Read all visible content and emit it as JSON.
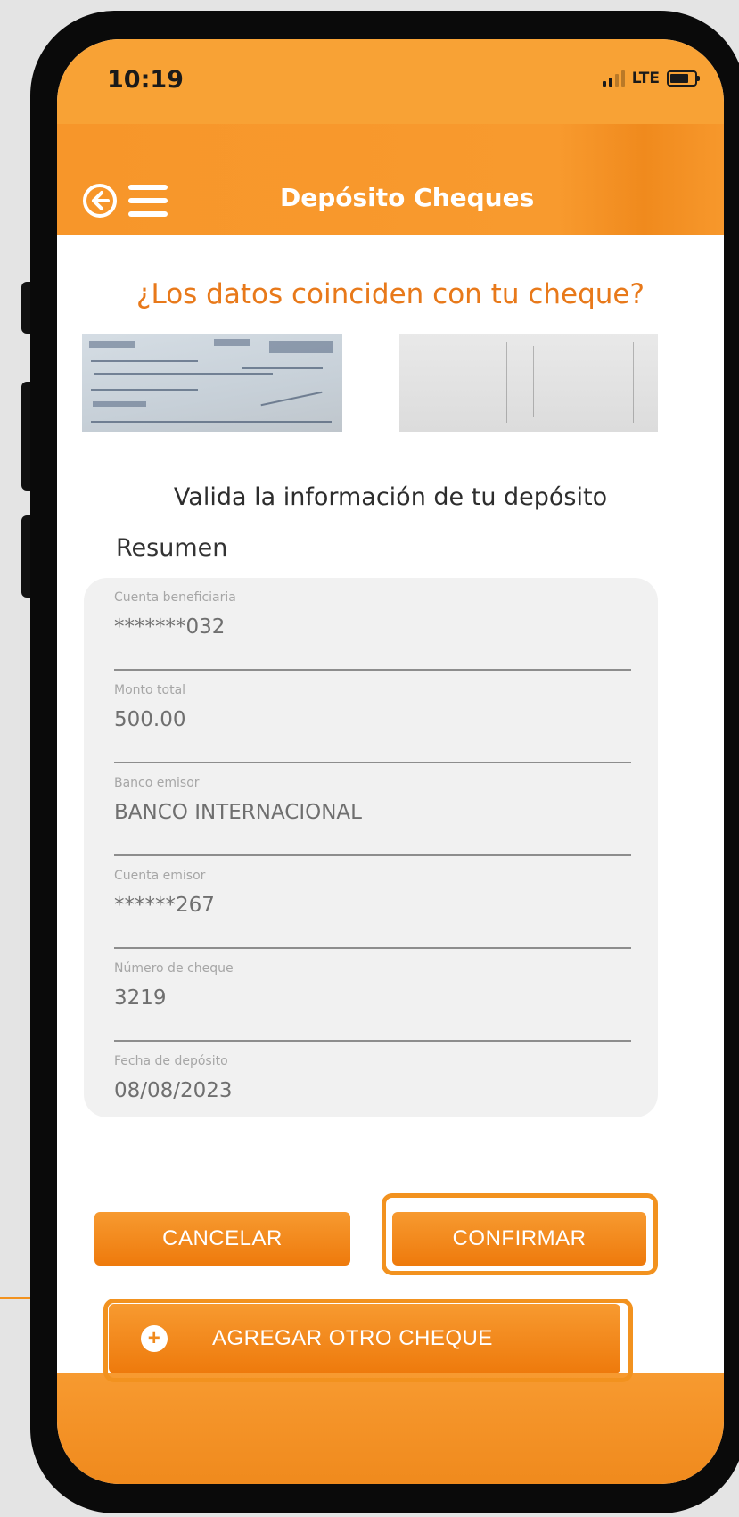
{
  "status_bar": {
    "time": "10:19",
    "network": "LTE"
  },
  "nav": {
    "title": "Depósito Cheques",
    "back_icon": "back-arrow-circle-icon",
    "menu_icon": "hamburger-menu-icon"
  },
  "question": "¿Los datos coinciden con tu cheque?",
  "subtitle": "Valida la información de tu depósito",
  "summary": {
    "title": "Resumen",
    "fields": [
      {
        "label": "Cuenta beneficiaria",
        "value": "*******032"
      },
      {
        "label": "Monto total",
        "value": "500.00"
      },
      {
        "label": "Banco emisor",
        "value": "BANCO INTERNACIONAL"
      },
      {
        "label": "Cuenta emisor",
        "value": "******267"
      },
      {
        "label": "Número de cheque",
        "value": "3219"
      },
      {
        "label": "Fecha de depósito",
        "value": "08/08/2023"
      }
    ]
  },
  "buttons": {
    "cancel": "CANCELAR",
    "confirm": "CONFIRMAR",
    "add_cheque": "AGREGAR OTRO CHEQUE"
  },
  "colors": {
    "accent": "#f7982c",
    "accent_dark": "#ee7a0c",
    "question": "#e8791a",
    "card_bg": "#f1f1f1"
  }
}
